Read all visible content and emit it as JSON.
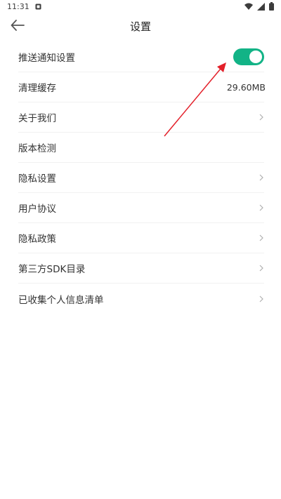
{
  "status_bar": {
    "time": "11:31",
    "notification_icon": "notification-icon",
    "wifi_icon": "wifi-icon",
    "signal_icon": "signal-icon",
    "battery_icon": "battery-icon"
  },
  "header": {
    "title": "设置",
    "back_icon": "arrow-left-icon"
  },
  "settings": {
    "items": [
      {
        "label": "推送通知设置",
        "control": "toggle",
        "toggle_on": true,
        "accent": "#12b386"
      },
      {
        "label": "清理缓存",
        "value": "29.60MB"
      },
      {
        "label": "关于我们",
        "chevron": true
      },
      {
        "label": "版本检测"
      },
      {
        "label": "隐私设置",
        "chevron": true
      },
      {
        "label": "用户协议",
        "chevron": true
      },
      {
        "label": "隐私政策",
        "chevron": true
      },
      {
        "label": "第三方SDK目录",
        "chevron": true
      },
      {
        "label": "已收集个人信息清单",
        "chevron": true
      }
    ]
  },
  "annotation": {
    "arrow_color": "#e3202a"
  }
}
